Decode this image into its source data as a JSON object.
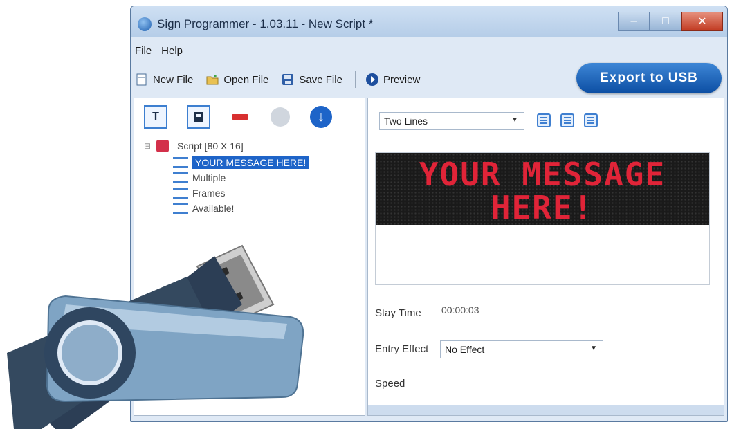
{
  "window": {
    "title": "Sign Programmer - 1.03.11 - New Script *",
    "controls": {
      "minimize": "–",
      "maximize": "□",
      "close": "✕"
    }
  },
  "menu": {
    "items": [
      "File",
      "Help"
    ]
  },
  "toolbar": {
    "new_file": "New File",
    "open_file": "Open File",
    "save_file": "Save File",
    "preview": "Preview",
    "export": "Export to USB"
  },
  "tree": {
    "root_label": "Script [80 X 16]",
    "items": [
      {
        "label": "YOUR MESSAGE HERE!",
        "selected": true
      },
      {
        "label": "Multiple",
        "selected": false
      },
      {
        "label": "Frames",
        "selected": false
      },
      {
        "label": "Available!",
        "selected": false
      }
    ]
  },
  "editor": {
    "lines_mode": "Two Lines",
    "led_line1": "YOUR MESSAGE",
    "led_line2": "HERE!",
    "led_color": "#e02438",
    "stay_time_label": "Stay Time",
    "stay_time_value": "00:00:03",
    "entry_effect_label": "Entry Effect",
    "entry_effect_value": "No Effect",
    "speed_label": "Speed"
  },
  "colors": {
    "accent": "#1e64c8",
    "led_background": "#1a1a1a"
  }
}
